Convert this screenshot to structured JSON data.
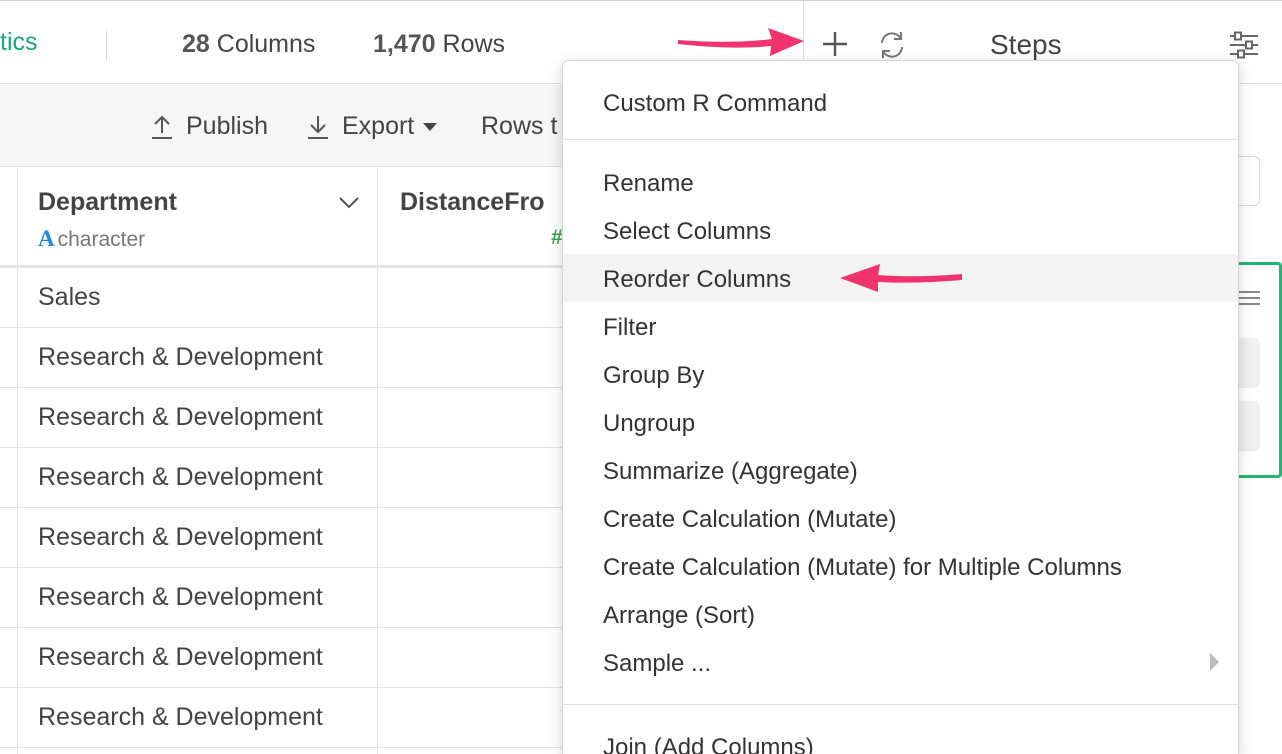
{
  "header": {
    "app_tab": "tics",
    "columns_count": "28",
    "columns_label": "Columns",
    "rows_count": "1,470",
    "rows_label": "Rows",
    "add_icon": "plus-icon",
    "refresh_icon": "refresh-icon",
    "steps_title": "Steps",
    "settings_icon": "sliders-icon"
  },
  "toolbar": {
    "publish_label": "Publish",
    "export_label": "Export",
    "rows_label": "Rows t"
  },
  "table": {
    "columns": [
      {
        "name": "Department",
        "type_glyph": "A",
        "type": "character"
      },
      {
        "name": "DistanceFro",
        "type_glyph": "#"
      }
    ],
    "rows": [
      "Sales",
      "Research & Development",
      "Research & Development",
      "Research & Development",
      "Research & Development",
      "Research & Development",
      "Research & Development",
      "Research & Development"
    ]
  },
  "dropdown": {
    "items": [
      "Custom R Command",
      "Rename",
      "Select Columns",
      "Reorder Columns",
      "Filter",
      "Group By",
      "Ungroup",
      "Summarize (Aggregate)",
      "Create Calculation (Mutate)",
      "Create Calculation (Mutate) for Multiple Columns",
      "Arrange (Sort)",
      "Sample ...",
      "Join (Add Columns)"
    ],
    "highlighted": "Reorder Columns"
  },
  "colors": {
    "accent_green": "#19a974",
    "annotation_arrow": "#f0326e",
    "type_character": "#1e88e5",
    "type_numeric": "#3aa757"
  }
}
